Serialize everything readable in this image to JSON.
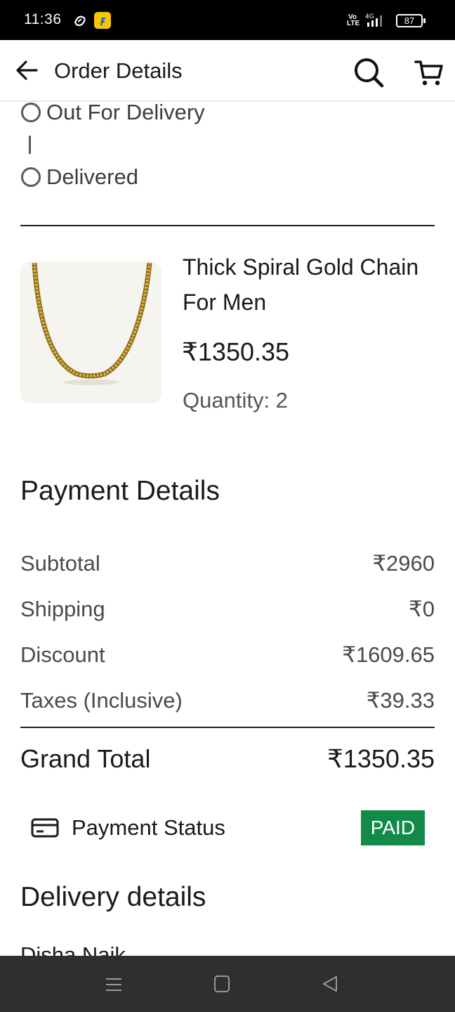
{
  "status_bar": {
    "time": "11:36",
    "volte": "Vo\nLTE",
    "network": "4G",
    "battery": "87"
  },
  "header": {
    "title": "Order Details"
  },
  "timeline": {
    "steps": [
      {
        "label": "Out For Delivery"
      },
      {
        "label": "Delivered"
      }
    ]
  },
  "product": {
    "name": "Thick Spiral Gold Chain For Men",
    "price": "₹1350.35",
    "quantity": "Quantity: 2"
  },
  "payment": {
    "heading": "Payment Details",
    "rows": [
      {
        "label": "Subtotal",
        "value": "₹2960"
      },
      {
        "label": "Shipping",
        "value": "₹0"
      },
      {
        "label": "Discount",
        "value": "₹1609.65"
      },
      {
        "label": "Taxes (Inclusive)",
        "value": "₹39.33"
      }
    ],
    "grand_total_label": "Grand Total",
    "grand_total_value": "₹1350.35",
    "status_label": "Payment Status",
    "status_badge": "PAID"
  },
  "delivery": {
    "heading": "Delivery details",
    "name": "Disha Naik"
  },
  "colors": {
    "paid_badge": "#138a4a",
    "status_bar": "#000000",
    "nav_bar": "#2f2f2f"
  }
}
